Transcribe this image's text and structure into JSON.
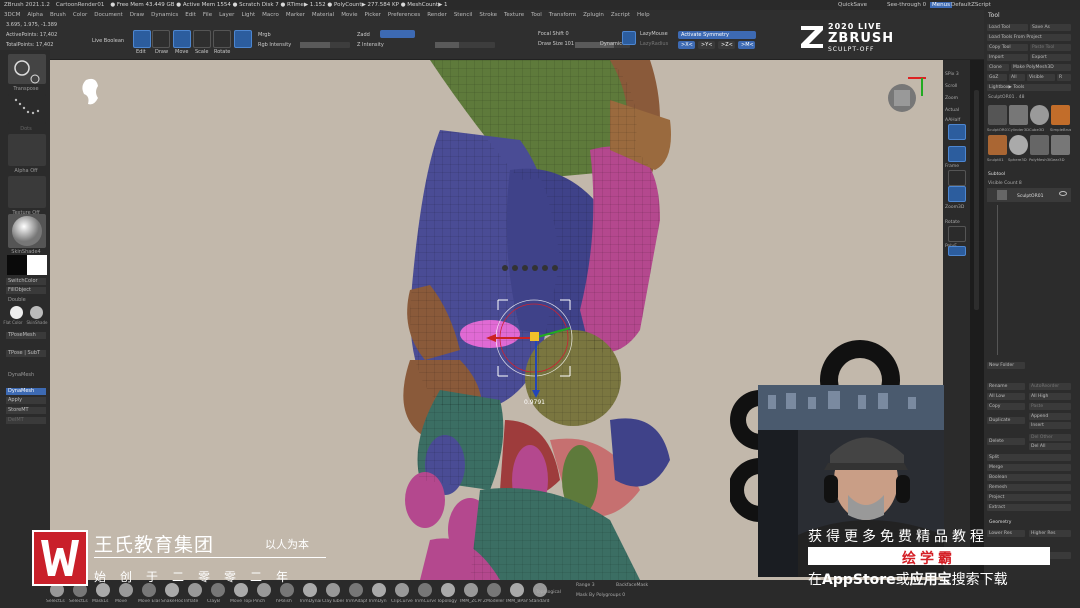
{
  "titlebar": {
    "app": "ZBrush 2021.1.2",
    "doc": "CartoonRender01",
    "stats": "● Free Mem 43.449 GB ● Active Mem 1554 ● Scratch Disk 7 ● RTime▶ 1.152 ● PolyCount▶ 277.584 KP ● MeshCount▶ 1",
    "quicksave": "QuickSave",
    "seethrough": "See-through 0",
    "menus": "Menus",
    "script": "DefaultZScript"
  },
  "menus": [
    "3DCM",
    "Alpha",
    "Brush",
    "Color",
    "Document",
    "Draw",
    "Dynamics",
    "Edit",
    "File",
    "Layer",
    "Light",
    "Macro",
    "Marker",
    "Material",
    "Movie",
    "Picker",
    "Preferences",
    "Render",
    "Stencil",
    "Stroke",
    "Texture",
    "Tool",
    "Transform",
    "Zplugin",
    "Zscript",
    "Help"
  ],
  "topbar": {
    "coords": "3.695, 1.975, -1.389",
    "activepoints": "ActivePoints: 17,402",
    "totalpoints": "TotalPoints: 17,402",
    "live_boolean": "Live Boolean",
    "edit": "Edit",
    "draw": "Draw",
    "move": "Move",
    "scale": "Scale",
    "rotate": "Rotate",
    "mrgb": "Mrgb",
    "rgb": "Rgb",
    "m": "M",
    "zadd": "Zadd",
    "zsub": "Zsub",
    "rgb_intensity": "Rgb Intensity",
    "z_intensity": "Z Intensity",
    "focal_shift": "Focal Shift 0",
    "draw_size": "Draw Size 101",
    "dynamic": "Dynamic",
    "lazymouse": "LazyMouse",
    "lazyradius": "LazyRadius",
    "activate_symmetry": "Activate Symmetry",
    "x": ">X<",
    "y": ">Y<",
    "z": ">Z<",
    "m2": ">M<"
  },
  "logo": {
    "line1": "2020  LIVE",
    "line2": "ZBRUSH",
    "line3": "SCULPT-OFF"
  },
  "left": {
    "transpose": "Transpose",
    "dots": "Dots",
    "alpha_off": "Alpha Off",
    "texture_off": "Texture Off",
    "material": "SkinShade4",
    "switch_color": "SwitchColor",
    "fill_object": "FillObject",
    "double": "Double",
    "flat_color": "Flat Color",
    "skin_shade": "SkinShade",
    "tpose_mesh": "TPoseMesh",
    "tpose_subt": "TPose | SubT",
    "dynamesh": "DynaMesh",
    "dynamesh_btn": "DynaMesh",
    "apply": "Apply",
    "store_mt": "StoreMT",
    "delete": "DelMT"
  },
  "right_tools": {
    "spix": "SPix 3",
    "scroll": "Scroll",
    "zoom": "Zoom",
    "actual": "Actual",
    "aahalf": "AAHalf",
    "persp": "Persp",
    "floor": "Floor",
    "frame": "Frame",
    "move": "Move",
    "zoom3d": "Zoom3D",
    "rotate": "Rotate",
    "line_fill": "Line Fill",
    "polyf": "PolyF",
    "transp": "Transp",
    "ghost": "Ghost",
    "solo": "Solo",
    "xpose": "Xpose"
  },
  "tool": {
    "title": "Tool",
    "load_tool": "Load Tool",
    "save_as": "Save As",
    "load_from_project": "Load Tools From Project",
    "copy_tool": "Copy Tool",
    "paste_tool": "Paste Tool",
    "import": "Import",
    "export": "Export",
    "clone": "Clone",
    "make_polymesh": "Make PolyMesh3D",
    "goz": "GoZ",
    "all": "All",
    "visible": "Visible",
    "r": "R",
    "lightbox": "Lightbox▶ Tools",
    "current": "SculptOR01 . 48",
    "thumbs": [
      "SculptOR01",
      "Cylinder3D",
      "Cube3D",
      "SimpleBrush",
      "Sculpt01",
      "Sphere3D",
      "PolyMesh3D",
      "Gear3D"
    ],
    "subtool": "Subtool",
    "visible_count": "Visible Count 8",
    "subtool_name": "SculptOR01",
    "new_folder": "New Folder",
    "rename": "Rename",
    "autoreorder": "AutoReorder",
    "all_low": "All Low",
    "all_high": "All High",
    "copy": "Copy",
    "paste": "Paste",
    "duplicate": "Duplicate",
    "append": "Append",
    "insert": "Insert",
    "delete": "Delete",
    "del_other": "Del Other",
    "del_all": "Del All",
    "split": "Split",
    "merge": "Merge",
    "boolean": "Boolean",
    "remesh": "Remesh",
    "project": "Project",
    "extract": "Extract",
    "geometry": "Geometry",
    "lower_res": "Lower Res",
    "higher_res": "Higher Res",
    "sdiv": "SDiv",
    "divide": "Divide",
    "smt": "Smt",
    "suv": "Suv"
  },
  "bottombar": {
    "brushes": [
      "SelectLs",
      "SelectLs",
      "MaskLs",
      "Move",
      "Move Elastic",
      "SnakeHook",
      "Inflate",
      "ClayB",
      "Move Topological",
      "Pinch",
      "hPolish",
      "TrimDynamic",
      "ClayTubes",
      "TrimAdaptive",
      "TrimDyn",
      "ClipCurve",
      "TrimCurve",
      "Topology",
      "IMM_ZCPrimitives",
      "ZModeler",
      "IMM_BParts",
      "Standard",
      "Topological"
    ],
    "range": "Range 3",
    "backface": "BackfaceMask",
    "mask_poly": "Mask By Polygroups 0"
  },
  "gizmo": {
    "value": "0.9791"
  },
  "watermark": {
    "company": "王氏教育集团",
    "slogan": "以人为本",
    "founded": "始创于二零零二年"
  },
  "promo": {
    "line1": "获得更多免费精品教程",
    "line2": "绘学霸",
    "line3_prefix": "在",
    "line3_store": "AppStore",
    "line3_or": "或",
    "line3_app": "应用宝",
    "line3_suffix": "搜索下载"
  },
  "colors": {
    "accent": "#2c5d9e",
    "viewport_bg": "#c2b8ab",
    "brand_red": "#c9202a"
  }
}
